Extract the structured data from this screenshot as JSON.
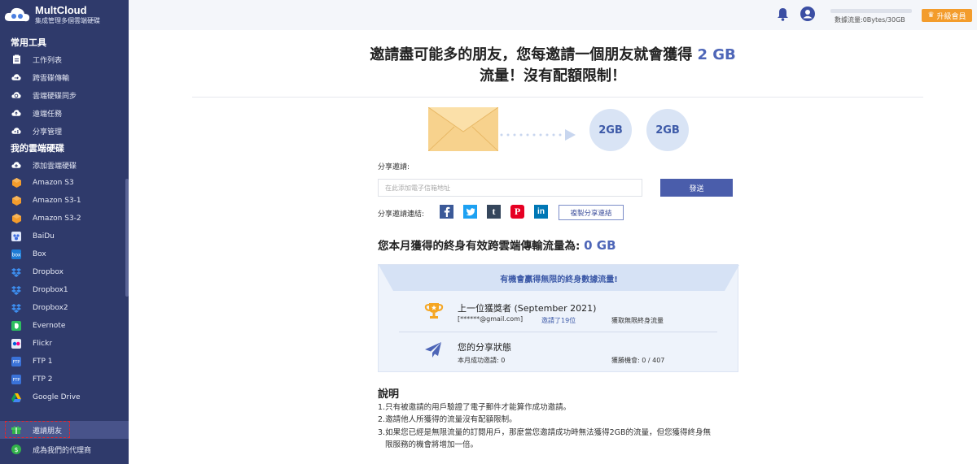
{
  "brand": {
    "name": "MultCloud",
    "tagline": "集成管理多個雲端硬碟"
  },
  "sidebar": {
    "section_tools": "常用工具",
    "tools": [
      {
        "label": "工作列表",
        "icon": "clipboard-icon"
      },
      {
        "label": "跨雲碟傳輸",
        "icon": "cloud-transfer-icon"
      },
      {
        "label": "雲端硬碟同步",
        "icon": "cloud-sync-icon"
      },
      {
        "label": "遠端任務",
        "icon": "cloud-upload-icon"
      },
      {
        "label": "分享管理",
        "icon": "cloud-share-icon"
      }
    ],
    "section_drives": "我的雲端硬碟",
    "drives": [
      {
        "label": "添加雲端硬碟",
        "icon": "cloud-add-icon"
      },
      {
        "label": "Amazon S3",
        "icon": "amazon-s3-icon"
      },
      {
        "label": "Amazon S3-1",
        "icon": "amazon-s3-icon"
      },
      {
        "label": "Amazon S3-2",
        "icon": "amazon-s3-icon"
      },
      {
        "label": "BaiDu",
        "icon": "baidu-icon"
      },
      {
        "label": "Box",
        "icon": "box-icon"
      },
      {
        "label": "Dropbox",
        "icon": "dropbox-icon"
      },
      {
        "label": "Dropbox1",
        "icon": "dropbox-icon"
      },
      {
        "label": "Dropbox2",
        "icon": "dropbox-icon"
      },
      {
        "label": "Evernote",
        "icon": "evernote-icon"
      },
      {
        "label": "Flickr",
        "icon": "flickr-icon"
      },
      {
        "label": "FTP 1",
        "icon": "ftp-icon"
      },
      {
        "label": "FTP 2",
        "icon": "ftp-icon"
      },
      {
        "label": "Google Drive",
        "icon": "google-drive-icon"
      }
    ],
    "invite": "邀請朋友",
    "agent": "成為我們的代理商"
  },
  "topbar": {
    "usage": "數據流量:0Bytes/30GB",
    "upgrade": "升級會員"
  },
  "main": {
    "headline_a": "邀請盡可能多的朋友，您每邀請一個朋友就會獲得 ",
    "headline_gb": "2 GB",
    "headline_b": "流量！沒有配額限制！",
    "gb1": "2GB",
    "gb2": "2GB",
    "share_label": "分享邀請:",
    "email_placeholder": "在此添加電子信箱地址",
    "send": "發送",
    "link_label": "分享邀請連結:",
    "copy_link": "複製分享連結",
    "lifetime_text": "您本月獲得的終身有效跨雲端傳輸流量為: ",
    "lifetime_value": "0 GB",
    "banner": "有機會贏得無限的終身數據流量!",
    "winner_title": "上一位獲獎者 (September 2021)",
    "winner_email": "[******@gmail.com]",
    "winner_invited": "邀請了19位",
    "winner_reward": "獲取無限終身流量",
    "status_title": "您的分享狀態",
    "status_success": "本月成功邀請: 0",
    "status_chance": "獲勝機會: 0 / 407",
    "notes_title": "說明",
    "note1": "1.只有被邀請的用戶驗證了電子郵件才能算作成功邀請。",
    "note2": "2.邀請他人所獲得的流量沒有配額限制。",
    "note3a": "3.如果您已經是無限流量的訂閱用戶，那麼當您邀請成功時無法獲得2GB的流量，但您獲得終身無",
    "note3b": "限服務的機會將增加一倍。"
  }
}
